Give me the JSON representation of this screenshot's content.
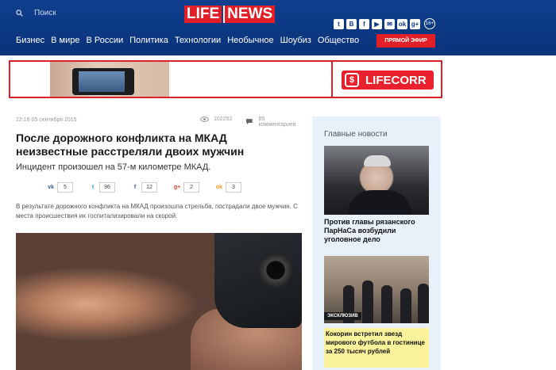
{
  "header": {
    "search_label": "Поиск",
    "logo_part1": "LIFE",
    "logo_part2": "NEWS",
    "social": [
      "t",
      "B",
      "f",
      "▶",
      "✉",
      "ok",
      "g+"
    ],
    "age_rating": "16+",
    "nav": [
      "Бизнес",
      "В мире",
      "В России",
      "Политика",
      "Технологии",
      "Необычное",
      "Шоубиз",
      "Общество"
    ],
    "live_button": "ПРЯМОЙ ЭФИР",
    "colors": {
      "bar": "#0d3a86",
      "accent": "#e21f26"
    }
  },
  "banner": {
    "brand": "LIFECORR"
  },
  "article": {
    "date": "22:16 05 сентября 2015",
    "views": "102252",
    "comments": "85 комментариев",
    "title": "После дорожного конфликта на МКАД неизвестные расстреляли двоих мужчин",
    "lead": "Инцидент произошел на 57-м километре МКАД.",
    "shares": [
      {
        "icon": "vk-icon",
        "glyph": "vk",
        "count": "5"
      },
      {
        "icon": "twitter-icon",
        "glyph": "t",
        "count": "96"
      },
      {
        "icon": "facebook-icon",
        "glyph": "f",
        "count": "12"
      },
      {
        "icon": "googleplus-icon",
        "glyph": "g+",
        "count": "2"
      },
      {
        "icon": "odnoklassniki-icon",
        "glyph": "ok",
        "count": "3"
      }
    ],
    "body": "В результате дорожного конфликта на МКАД произошла стрельба, пострадали двое мужчин. С места происшествия их госпитализировали на скорой."
  },
  "sidebar": {
    "header": "Главные новости",
    "items": [
      {
        "title": "Против главы рязанского ПарНаСа возбудили уголовное дело"
      },
      {
        "title": "Кокорин встретил звезд мирового футбола в гостинице за 250 тысяч рублей",
        "tag": "ЭКСКЛЮЗИВ"
      }
    ]
  }
}
